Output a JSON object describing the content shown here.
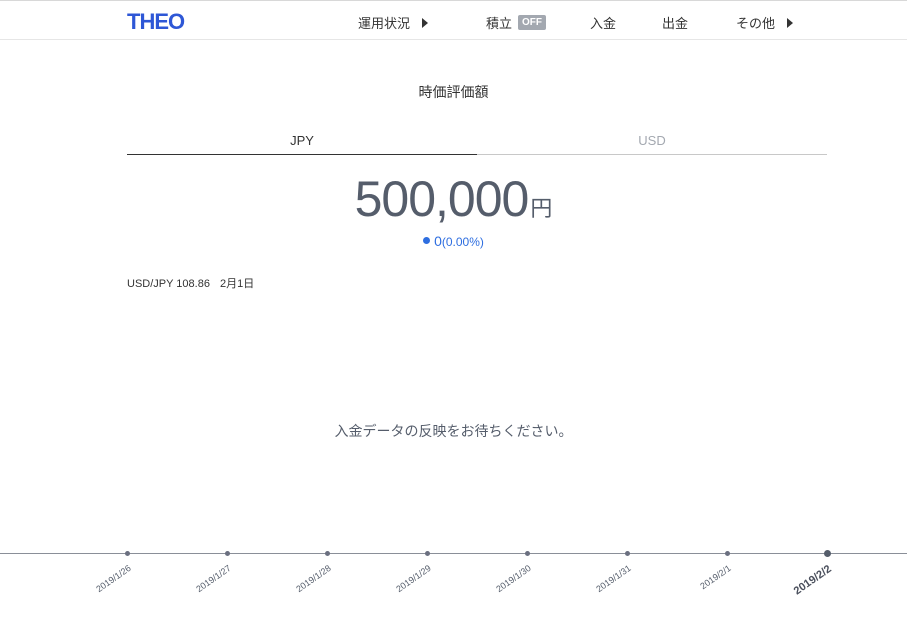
{
  "header": {
    "logo": "THEO",
    "nav": [
      {
        "label": "運用状況",
        "has_arrow": true
      },
      {
        "label": "積立",
        "badge": "OFF"
      },
      {
        "label": "入金"
      },
      {
        "label": "出金"
      },
      {
        "label": "その他",
        "has_arrow": true
      }
    ]
  },
  "main": {
    "title": "時価評価額",
    "tabs": [
      {
        "label": "JPY",
        "active": true
      },
      {
        "label": "USD",
        "active": false
      }
    ],
    "amount": "500,000",
    "amount_unit": "円",
    "change_value": "0",
    "change_pct": "(0.00%)",
    "fx_label": "USD/JPY 108.86",
    "fx_date": "2月1日",
    "message": "入金データの反映をお待ちください。"
  },
  "timeline": {
    "dates": [
      "2019/1/26",
      "2019/1/27",
      "2019/1/28",
      "2019/1/29",
      "2019/1/30",
      "2019/1/31",
      "2019/2/1",
      "2019/2/2"
    ],
    "selected": "2019/2/2"
  },
  "colors": {
    "brand": "#2e57d6",
    "accent_blue": "#2e6ee0",
    "text_dark": "#333333",
    "text_gray": "#a3a8b0",
    "amount_gray": "#555d6b"
  }
}
